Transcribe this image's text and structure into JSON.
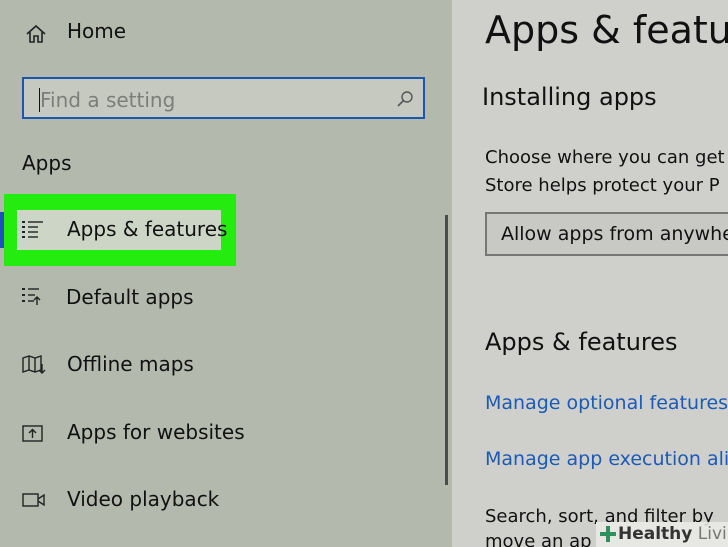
{
  "sidebar": {
    "home_label": "Home",
    "search_placeholder": "Find a setting",
    "section_title": "Apps",
    "items": [
      {
        "label": "Apps & features",
        "icon": "list-icon"
      },
      {
        "label": "Default apps",
        "icon": "default-apps-icon"
      },
      {
        "label": "Offline maps",
        "icon": "map-icon"
      },
      {
        "label": "Apps for websites",
        "icon": "open-in-icon"
      },
      {
        "label": "Video playback",
        "icon": "video-icon"
      }
    ]
  },
  "main": {
    "page_title": "Apps & feature",
    "installing_heading": "Installing apps",
    "installing_text_1": "Choose where you can get",
    "installing_text_2": "Store helps protect your P",
    "dropdown_value": "Allow apps from anywhe",
    "features_heading": "Apps & features",
    "link_optional": "Manage optional features",
    "link_aliases": "Manage app execution alia",
    "search_text_1": "Search, sort, and filter by",
    "search_text_2": "move an ap"
  },
  "watermark": {
    "text_bold": "Healthy",
    "text_light": " Living"
  },
  "colors": {
    "highlight": "#24ec0e",
    "accent": "#1b56b0",
    "link": "#1b5ab5"
  }
}
